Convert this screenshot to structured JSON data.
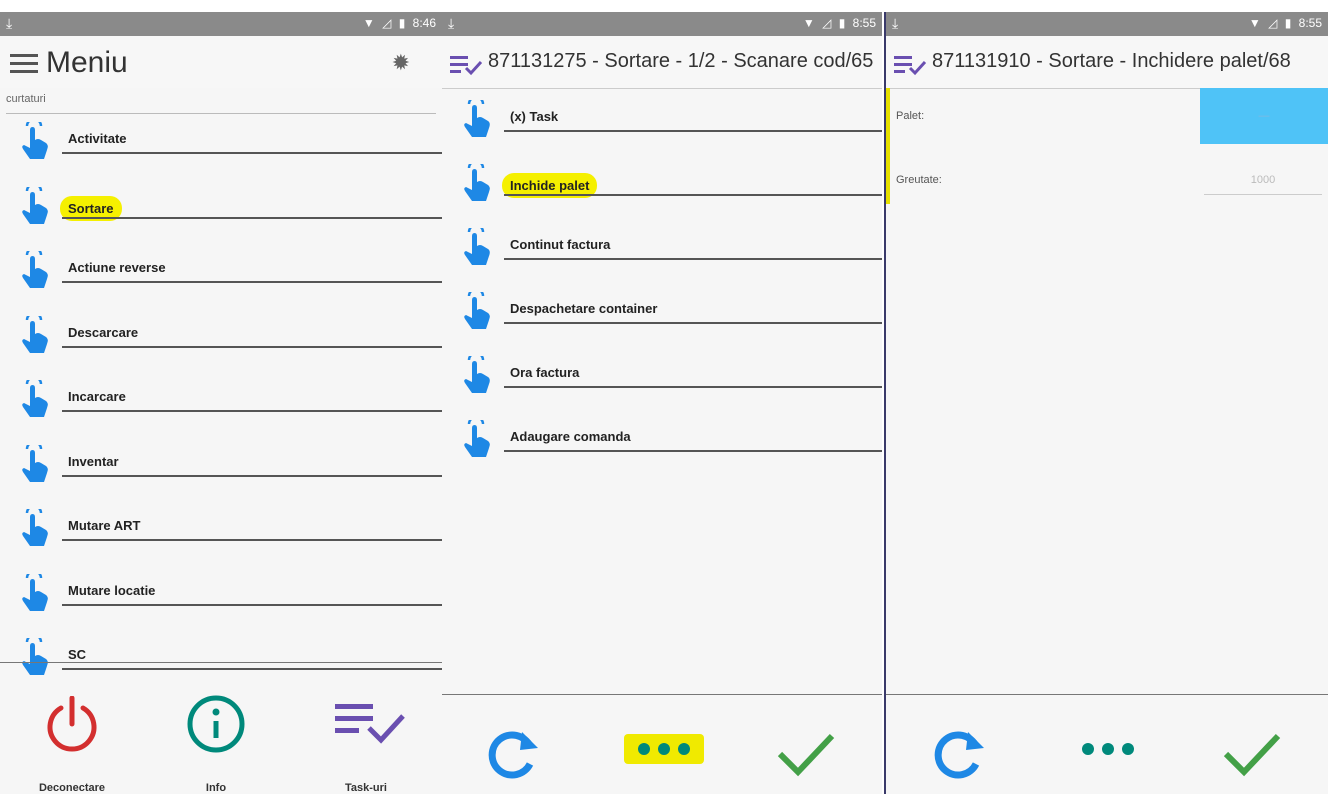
{
  "status": {
    "download_icon": "download-arrow-icon",
    "wifi_icon": "wifi-icon",
    "signal_icon": "signal-icon",
    "battery_icon": "battery-icon",
    "p1_time": "8:46",
    "p2_time": "8:55",
    "p3_time": "8:55"
  },
  "panel1": {
    "title": "Meniu",
    "search_placeholder": "curtaturi",
    "items": [
      {
        "label": "Activitate"
      },
      {
        "label": "Sortare",
        "highlighted": true
      },
      {
        "label": "Actiune reverse"
      },
      {
        "label": "Descarcare"
      },
      {
        "label": "Incarcare"
      },
      {
        "label": "Inventar"
      },
      {
        "label": "Mutare ART"
      },
      {
        "label": "Mutare locatie"
      },
      {
        "label": "SC"
      }
    ],
    "bottom": {
      "disconnect_label": "Deconectare",
      "info_label": "Info",
      "tasks_label": "Task-uri"
    },
    "colors": {
      "power": "#d32f2f",
      "info": "#00897b",
      "tasks": "#6a4fb0",
      "hand": "#1e88e5"
    }
  },
  "panel2": {
    "title": "871131275 - Sortare - 1/2 - Scanare cod/65",
    "items": [
      {
        "label": "(x) Task"
      },
      {
        "label": "Inchide palet",
        "highlighted": true
      },
      {
        "label": "Continut factura"
      },
      {
        "label": "Despachetare container"
      },
      {
        "label": "Ora factura"
      },
      {
        "label": "Adaugare comanda"
      }
    ],
    "colors": {
      "refresh": "#1e88e5",
      "dots": "#00897b",
      "check": "#43a047",
      "highlight": "#f5f000"
    }
  },
  "panel3": {
    "title": "871131910 - Sortare - Inchidere palet/68",
    "fields": [
      {
        "label": "Palet:",
        "value": "—"
      },
      {
        "label": "Greutate:",
        "value": "1000"
      }
    ],
    "colors": {
      "palet_box": "#4fc3f7"
    }
  }
}
